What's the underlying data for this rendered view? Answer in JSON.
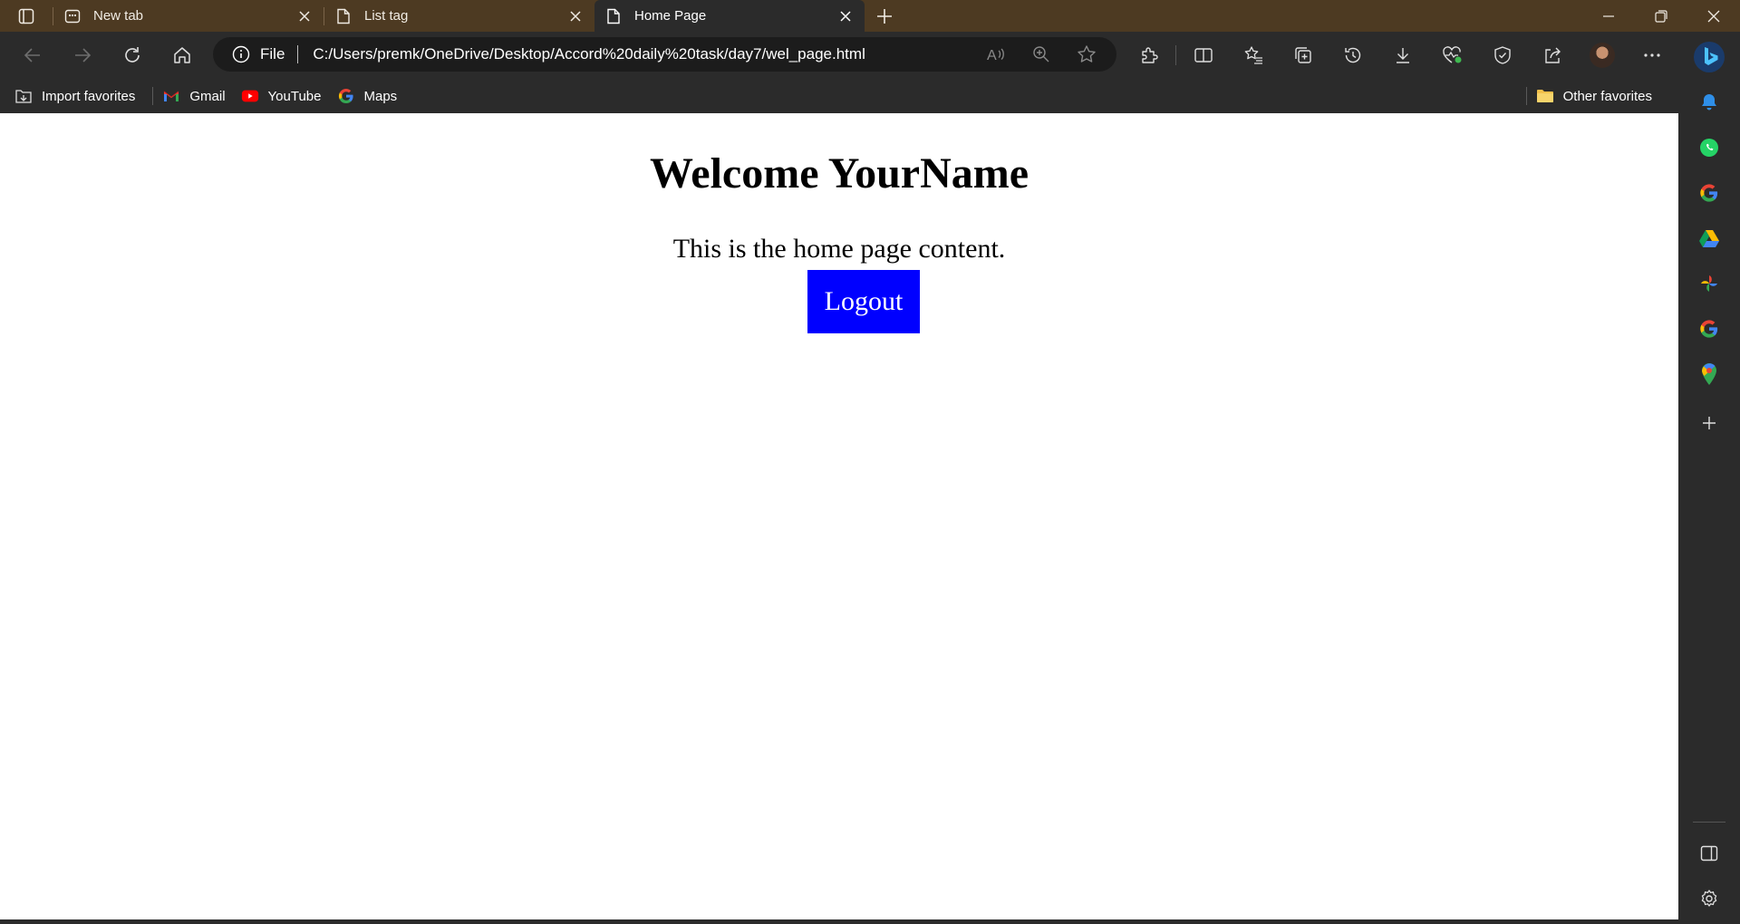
{
  "browser": {
    "tabs": [
      {
        "title": "New tab",
        "icon": "newtab-icon",
        "active": false
      },
      {
        "title": "List tag",
        "icon": "page-icon",
        "active": false
      },
      {
        "title": "Home Page",
        "icon": "page-icon",
        "active": true
      }
    ],
    "address": {
      "scheme_label": "File",
      "url": "C:/Users/premk/OneDrive/Desktop/Accord%20daily%20task/day7/wel_page.html"
    },
    "favorites": [
      {
        "label": "Import favorites",
        "icon": "import-favorites-icon"
      },
      {
        "label": "Gmail",
        "icon": "gmail-icon"
      },
      {
        "label": "YouTube",
        "icon": "youtube-icon"
      },
      {
        "label": "Maps",
        "icon": "google-icon"
      }
    ],
    "other_favorites_label": "Other favorites",
    "colors": {
      "tabstrip": "#4d3a22",
      "toolbar": "#2b2b2b",
      "address_bg": "#1c1c1c"
    }
  },
  "page": {
    "heading": "Welcome YourName",
    "paragraph": "This is the home page content.",
    "logout_label": "Logout",
    "logout_color": "#0000ff"
  }
}
